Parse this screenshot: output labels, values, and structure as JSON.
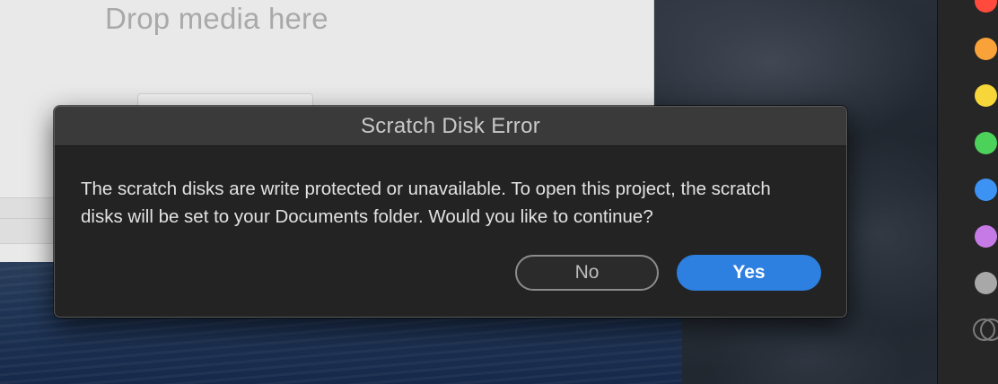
{
  "project_panel": {
    "drop_text": "Drop media here"
  },
  "dialog": {
    "title": "Scratch Disk Error",
    "message": "The scratch disks are write protected or unavailable. To open this project, the scratch disks will be set to your Documents folder. Would you like to continue?",
    "buttons": {
      "no": "No",
      "yes": "Yes"
    }
  },
  "label_colors": {
    "red": "#ff4a3d",
    "orange": "#f9a23a",
    "yellow": "#f7d63a",
    "green": "#4cd25a",
    "blue": "#3c93f3",
    "purple": "#c57ae6",
    "gray": "#a8a8a8"
  },
  "accent_color": "#2d7fe0"
}
